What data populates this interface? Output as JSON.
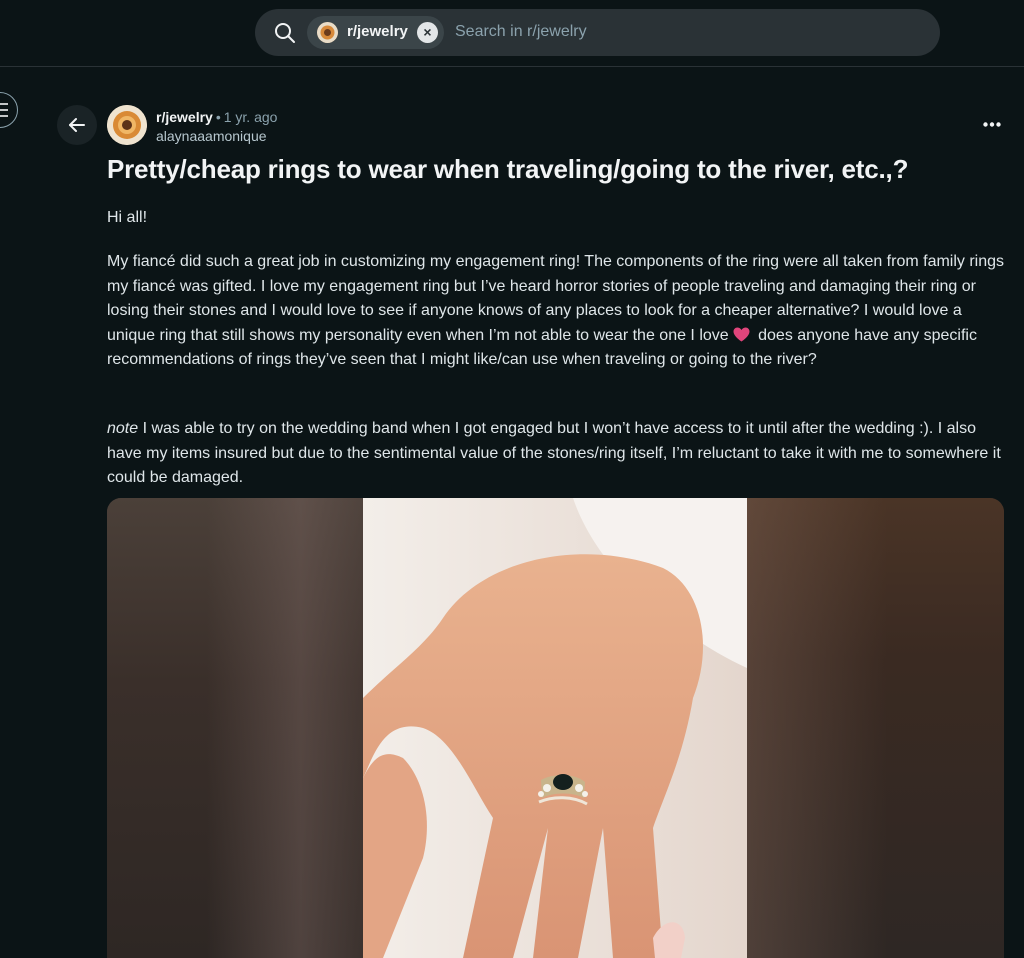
{
  "search": {
    "chip_label": "r/jewelry",
    "placeholder": "Search in r/jewelry"
  },
  "post": {
    "subreddit": "r/jewelry",
    "separator": "•",
    "time": "1 yr. ago",
    "author": "alaynaaamonique",
    "title": "Pretty/cheap rings to wear when traveling/going to the river, etc.,?",
    "body": {
      "greeting": "Hi all!",
      "para2_a": "My fiancé did such a great job in customizing my engagement ring! The components of the ring were all taken from family rings my fiancé was gifted. I love my engagement ring but I’ve heard horror stories of people traveling and damaging their ring or losing their stones and I would love to see if anyone knows of any places to look for a cheaper alternative? I would love a unique ring that still shows my personality even when I’m not able to wear the one I love",
      "para2_b": "does anyone have any specific recommendations of rings they’ve seen that I might like/can use when traveling or going to the river?",
      "note_label": "note",
      "para3": " I was able to try on the wedding band when I got engaged but I won’t have access to it until after the wedding :). I also have my items insured but due to the sentimental value of the stones/ring itself, I’m reluctant to take it with me to somewhere it could be damaged."
    }
  },
  "icons": {
    "search": "search-icon",
    "clear": "close-icon",
    "back": "arrow-left-icon",
    "more": "more-horizontal-icon",
    "heart": "pink-heart-emoji",
    "sidebar": "menu-icon"
  },
  "colors": {
    "background": "#0b1416",
    "search_bg": "#2a3236",
    "heart": "#e0457b"
  }
}
